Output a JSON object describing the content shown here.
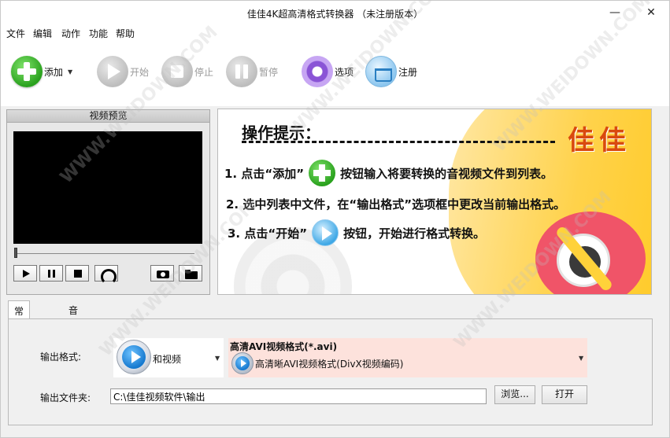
{
  "window": {
    "title": "佳佳4K超高清格式转换器 （未注册版本）",
    "minimize_glyph": "—",
    "maximize_glyph": "☐",
    "close_glyph": "✕"
  },
  "menu": [
    "文件",
    "编辑",
    "动作",
    "功能",
    "帮助"
  ],
  "toolbar": {
    "add": "添加",
    "start": "开始",
    "stop": "停止",
    "pause": "暂停",
    "options": "选项",
    "register": "注册"
  },
  "preview": {
    "title": "视频预览",
    "position": 0
  },
  "banner": {
    "heading": "操作提示：",
    "brand": "佳佳",
    "step1_a": "1. 点击“添加”",
    "step1_b": "按钮输入将要转换的音视频文件到列表。",
    "step2": "2. 选中列表中文件，在“输出格式”选项框中更改当前输出格式。",
    "step3_a": "3. 点击“开始”",
    "step3_b": "按钮，开始进行格式转换。"
  },
  "tabs": [
    "常规设置",
    "音视频高级设置"
  ],
  "settings": {
    "output_format_label": "输出格式:",
    "format_category": "和视频",
    "format_title": "高清AVI视频格式(*.avi)",
    "format_subtitle": "高清晰AVI视频格式(DivX视频编码)",
    "output_folder_label": "输出文件夹:",
    "output_folder_value": "C:\\佳佳视频软件\\输出",
    "browse_button": "浏览...",
    "open_button": "打开"
  },
  "watermark": "WWW.WEIDOWN.COM"
}
